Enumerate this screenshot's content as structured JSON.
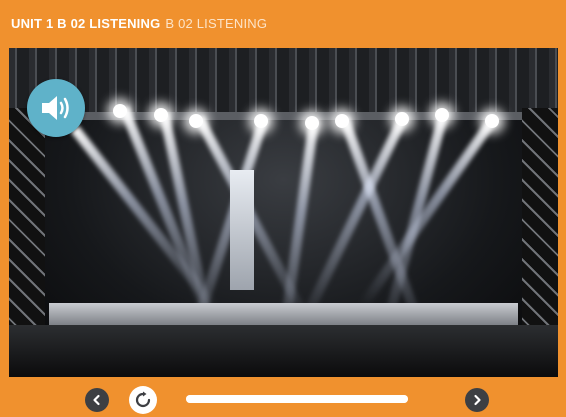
{
  "header": {
    "title_bold": "UNIT 1 B 02 LISTENING",
    "title_light": "B 02 LISTENING"
  },
  "colors": {
    "frame_orange": "#f0912e",
    "sound_button_blue": "#5fb2c9",
    "nav_button_dark": "#3d3f43"
  },
  "media": {
    "image_description_icon": "concert-stage-lights"
  },
  "player": {
    "sound_icon": "speaker-volume-icon",
    "prev_icon": "chevron-left-icon",
    "replay_icon": "replay-icon",
    "next_icon": "chevron-right-icon",
    "progress": 1.0
  }
}
